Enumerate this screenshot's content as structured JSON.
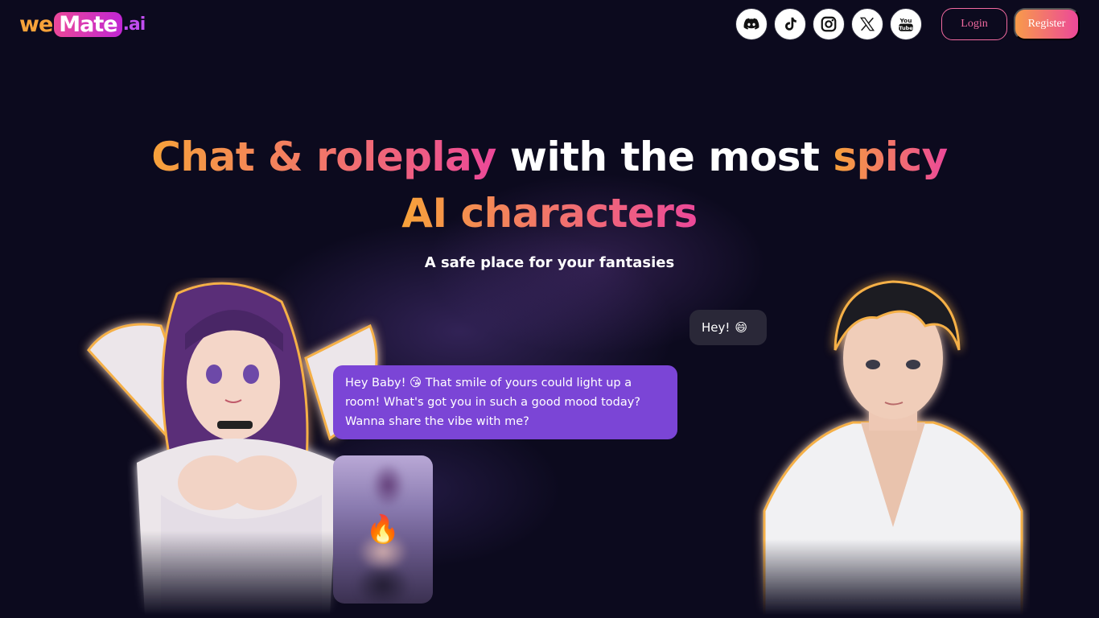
{
  "header": {
    "logo": {
      "we": "we",
      "mate": "Mate",
      "ai": ".ai"
    },
    "social": [
      "discord-icon",
      "tiktok-icon",
      "instagram-icon",
      "x-icon",
      "youtube-icon"
    ],
    "youtube_label_top": "You",
    "youtube_label_bottom": "Tube",
    "login_label": "Login",
    "register_label": "Register"
  },
  "hero": {
    "title_part1": "Chat & roleplay",
    "title_part2": " with the most ",
    "title_part3": "spicy",
    "title_line2": "AI characters",
    "subtitle": "A safe place for your fantasies"
  },
  "chat": {
    "user_message": "Hey!",
    "user_emoji": "😄",
    "bot_message": "Hey Baby! 😘 That smile of yours could light up a room! What's got you in such a good mood today? Wanna share the vibe with me?",
    "photo_emoji": "🔥"
  },
  "colors": {
    "background": "#0c0a1e",
    "accent_orange": "#f7a23a",
    "accent_pink": "#ec4899",
    "bot_bubble": "#7b45d6",
    "user_bubble": "#2a2838"
  }
}
